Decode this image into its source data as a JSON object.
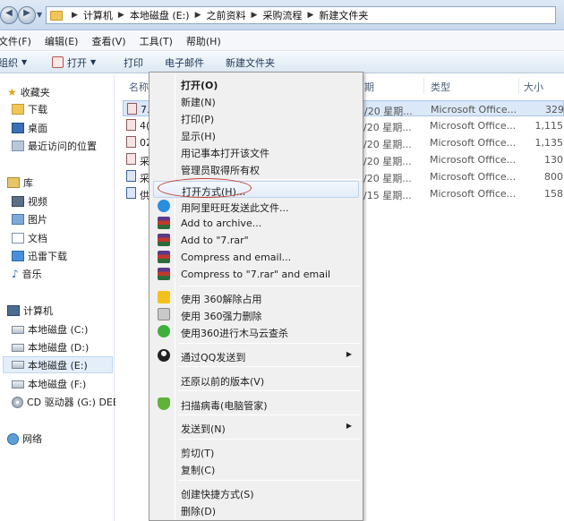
{
  "address": {
    "crumbs": [
      "计算机",
      "本地磁盘 (E:)",
      "之前资料",
      "采购流程",
      "新建文件夹"
    ]
  },
  "menubar": [
    "文件(F)",
    "编辑(E)",
    "查看(V)",
    "工具(T)",
    "帮助(H)"
  ],
  "toolbar": {
    "organize": "组织",
    "open": "打开",
    "print": "打印",
    "email": "电子邮件",
    "new_folder": "新建文件夹"
  },
  "navpane": {
    "favorites": "收藏夹",
    "downloads": "下载",
    "desktop": "桌面",
    "recent": "最近访问的位置",
    "libraries": "库",
    "videos": "视频",
    "pictures": "图片",
    "documents": "文档",
    "xunlei": "迅雷下载",
    "music": "音乐",
    "computer": "计算机",
    "drive_c": "本地磁盘 (C:)",
    "drive_d": "本地磁盘 (D:)",
    "drive_e": "本地磁盘 (E:)",
    "drive_f": "本地磁盘 (F:)",
    "drive_g": "CD 驱动器 (G:) DEE",
    "network": "网络"
  },
  "filelist": {
    "headers": {
      "name": "名称",
      "date": "期",
      "type": "类型",
      "size": "大小"
    },
    "rows": [
      {
        "name": "7.",
        "date": "3/20 星期...",
        "type": "Microsoft Office...",
        "size": "329"
      },
      {
        "name": "4(",
        "date": "3/20 星期...",
        "type": "Microsoft Office...",
        "size": "1,115"
      },
      {
        "name": "02",
        "date": "3/20 星期...",
        "type": "Microsoft Office...",
        "size": "1,135"
      },
      {
        "name": "采",
        "date": "3/20 星期...",
        "type": "Microsoft Office...",
        "size": "130"
      },
      {
        "name": "采",
        "date": "3/20 星期...",
        "type": "Microsoft Office...",
        "size": "800"
      },
      {
        "name": "供",
        "date": "3/15 星期...",
        "type": "Microsoft Office...",
        "size": "158"
      }
    ]
  },
  "context_menu": {
    "open": "打开(O)",
    "new": "新建(N)",
    "print": "打印(P)",
    "show": "显示(H)",
    "notepad": "用记事本打开该文件",
    "admin": "管理员取得所有权",
    "open_with": "打开方式(H)...",
    "aliwangwang": "用阿里旺旺发送此文件...",
    "add_archive": "Add to archive...",
    "add_rar": "Add to \"7.rar\"",
    "compress_email": "Compress and email...",
    "compress_rar_email": "Compress to \"7.rar\" and email",
    "unlock360": "使用 360解除占用",
    "delete360": "使用 360强力删除",
    "scan360": "使用360进行木马云查杀",
    "qq_send": "通过QQ发送到",
    "restore": "还原以前的版本(V)",
    "virus_scan": "扫描病毒(电脑管家)",
    "send_to": "发送到(N)",
    "cut": "剪切(T)",
    "copy": "复制(C)",
    "shortcut": "创建快捷方式(S)",
    "delete": "删除(D)"
  }
}
